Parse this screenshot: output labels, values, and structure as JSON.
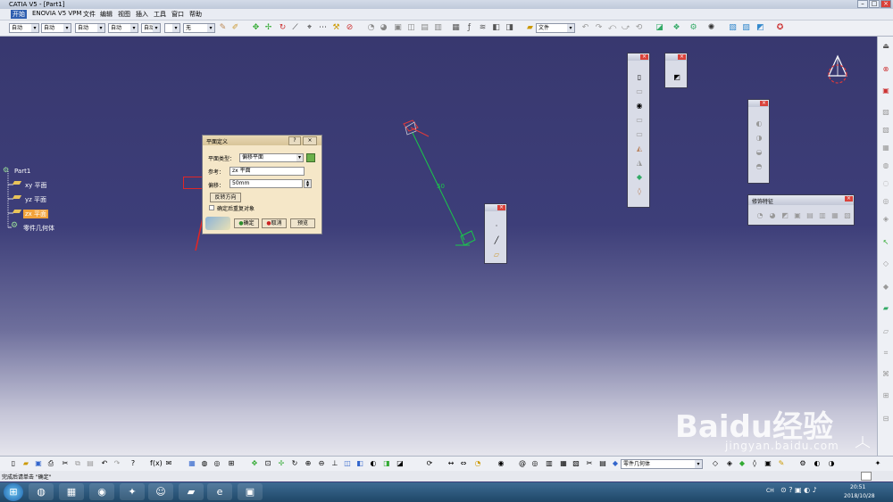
{
  "window": {
    "title": "CATIA V5 - [Part1]"
  },
  "menu": [
    "开始",
    "ENOVIA V5 VPM",
    "文件",
    "编辑",
    "视图",
    "插入",
    "工具",
    "窗口",
    "帮助"
  ],
  "toolbar_top": {
    "combos": [
      "自动",
      "自动",
      "自动",
      "自动",
      "自动",
      "无"
    ],
    "file_combo": "文件"
  },
  "tree": {
    "root": "Part1",
    "items": [
      "xy 平面",
      "yz 平面",
      "zx 平面",
      "零件几何体"
    ],
    "selected_index": 2
  },
  "viewport": {
    "offset_label": "50",
    "line_color": "#19c84a",
    "plane_color": "#e03a3a"
  },
  "dialog": {
    "title": "平面定义",
    "help": "?",
    "close": "×",
    "type_label": "平面类型：",
    "type_value": "偏移平面",
    "ref_label": "参考：",
    "ref_value": "zx 平面",
    "offset_label": "偏移：",
    "offset_value": "50mm",
    "reverse_btn": "反转方向",
    "repeat_label": "确定后重复对象",
    "ok": "确定",
    "cancel": "取消",
    "preview": "预览"
  },
  "palettes": {
    "modify": {
      "title": "修饰特征"
    }
  },
  "bottom": {
    "combo": "零件几何体"
  },
  "status": {
    "text": "完成后请单击 \"确定\""
  },
  "taskbar": {
    "time": "20:51",
    "date": "2018/10/28",
    "tray": "CH"
  },
  "watermark": {
    "brand": "Baidu经验",
    "url": "jingyan.baidu.com"
  },
  "colors": {
    "annotation": "#e02626",
    "selection": "#f1a23a"
  }
}
